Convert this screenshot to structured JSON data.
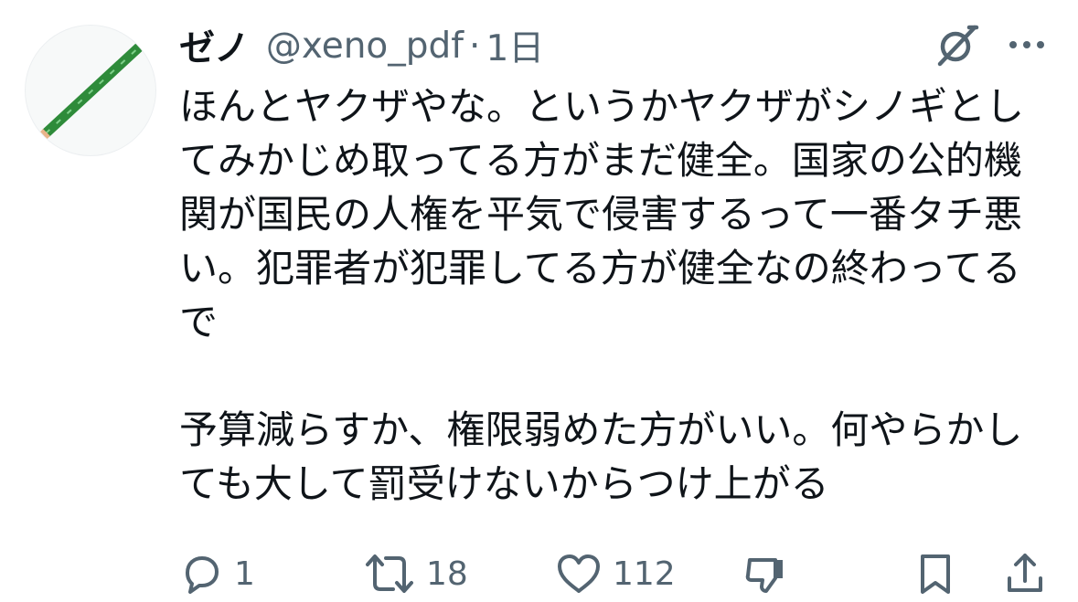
{
  "author": {
    "display_name": "ゼノ",
    "handle": "@xeno_pdf",
    "separator": "·",
    "time": "1日",
    "avatar_icon": "green-stick-avatar"
  },
  "tweet": {
    "paragraph1": "ほんとヤクザやな。というかヤクザがシノギとしてみかじめ取ってる方がまだ健全。国家の公的機関が国民の人権を平気で侵害するって一番タチ悪い。犯罪者が犯罪してる方が健全なの終わってるで",
    "paragraph2": "予算減らすか、権限弱めた方がいい。何やらかしても大して罰受けないからつけ上がる"
  },
  "header_icons": {
    "grok": "grok-icon",
    "more": "more-dots-icon"
  },
  "actions": {
    "reply_count": "1",
    "repost_count": "18",
    "like_count": "112",
    "dislike_icon": "thumbs-down-icon",
    "bookmark_icon": "bookmark-icon",
    "share_icon": "share-icon"
  },
  "colors": {
    "text_primary": "#0f1419",
    "text_secondary": "#536471",
    "avatar_stick": "#2e8b3a"
  }
}
